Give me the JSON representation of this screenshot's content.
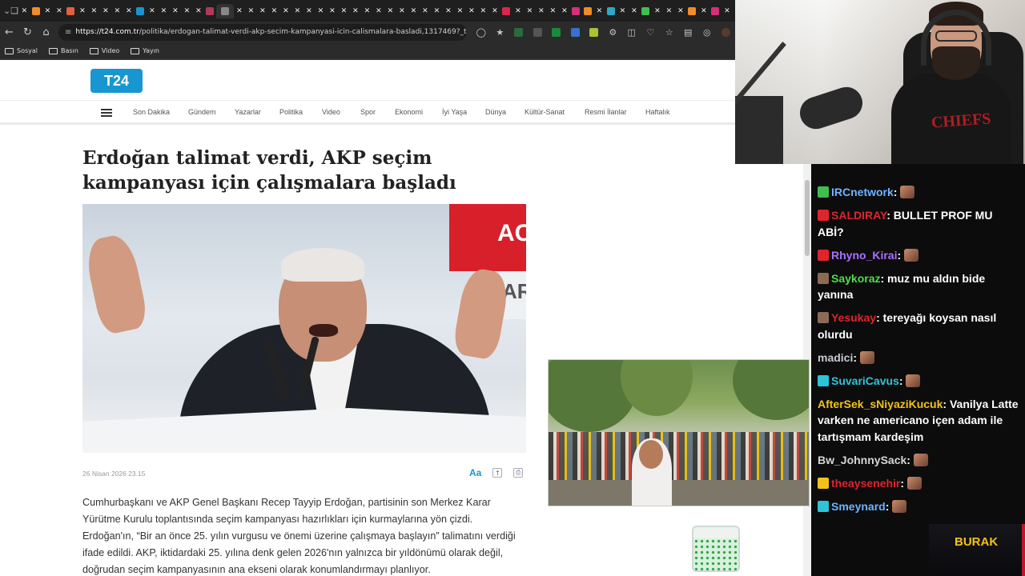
{
  "browser": {
    "url_host": "https://t24.com.tr",
    "url_path": "/politika/erdogan-talimat-verdi-akp-secim-kampanyasi-icin-calismalara-basladi,1317469?_t=17772...",
    "new_tab_symbol": "+",
    "bookmarks": [
      "Sosyal",
      "Basın",
      "Video",
      "Yayın"
    ]
  },
  "site": {
    "logo": "T24",
    "nav": [
      "Son Dakika",
      "Gündem",
      "Yazarlar",
      "Politika",
      "Video",
      "Spor",
      "Ekonomi",
      "İyi Yaşa",
      "Dünya",
      "Kültür-Sanat",
      "Resmi İlanlar",
      "Haftalık"
    ]
  },
  "article": {
    "headline_line1": "Erdoğan talimat verdi, AKP seçim",
    "headline_line2": "kampanyası için çalışmalara başladı",
    "hero_banner_text": "AC",
    "hero_banner_text2": "AR",
    "date": "26 Nisan 2026 23.15",
    "font_tool": "Aa",
    "body": "Cumhurbaşkanı ve AKP Genel Başkanı Recep Tayyip Erdoğan, partisinin son Merkez Karar Yürütme Kurulu toplantısında seçim kampanyası hazırlıkları için kurmaylarına yön çizdi. Erdoğan'ın, “Bir an önce 25. yılın vurgusu ve önemi üzerine çalışmaya başlayın” talimatını verdiği ifade edildi. AKP, iktidardaki 25. yılına denk gelen 2026'nın yalnızca bir yıldönümü olarak değil, doğrudan seçim kampanyasının ana ekseni olarak konumlandırmayı planlıyor."
  },
  "webcam": {
    "shirt_text": "CHIEFS"
  },
  "chat": {
    "messages": [
      {
        "user": "IRCnetwork",
        "color": "#6fb3ff",
        "text": ""
      },
      {
        "user": "SALDIRAY",
        "color": "#e0242c",
        "text": "BULLET PROF MU ABİ?"
      },
      {
        "user": "Rhyno_Kirai",
        "color": "#a970ff",
        "text": ""
      },
      {
        "user": "Saykoraz",
        "color": "#4fdd4a",
        "text": "muz mu aldın bide yanına"
      },
      {
        "user": "Yesukay",
        "color": "#e0242c",
        "text": "tereyağı koysan nasıl olurdu"
      },
      {
        "user": "madici",
        "color": "#c9c9d0",
        "text": ""
      },
      {
        "user": "SuvariCavus",
        "color": "#2ec4d8",
        "text": ""
      },
      {
        "user": "AfterSek_sNiyaziKucuk",
        "color": "#f4c21a",
        "text": "Vanilya Latte varken ne americano içen adam ile tartışmam kardeşim"
      },
      {
        "user": "Bw_JohnnySack",
        "color": "#d6d6d6",
        "text": ""
      },
      {
        "user": "theaysenehir",
        "color": "#e0242c",
        "text": ""
      },
      {
        "user": "Smeynard",
        "color": "#6fb3ff",
        "text": ""
      }
    ],
    "overlay_name": "BURAK"
  }
}
